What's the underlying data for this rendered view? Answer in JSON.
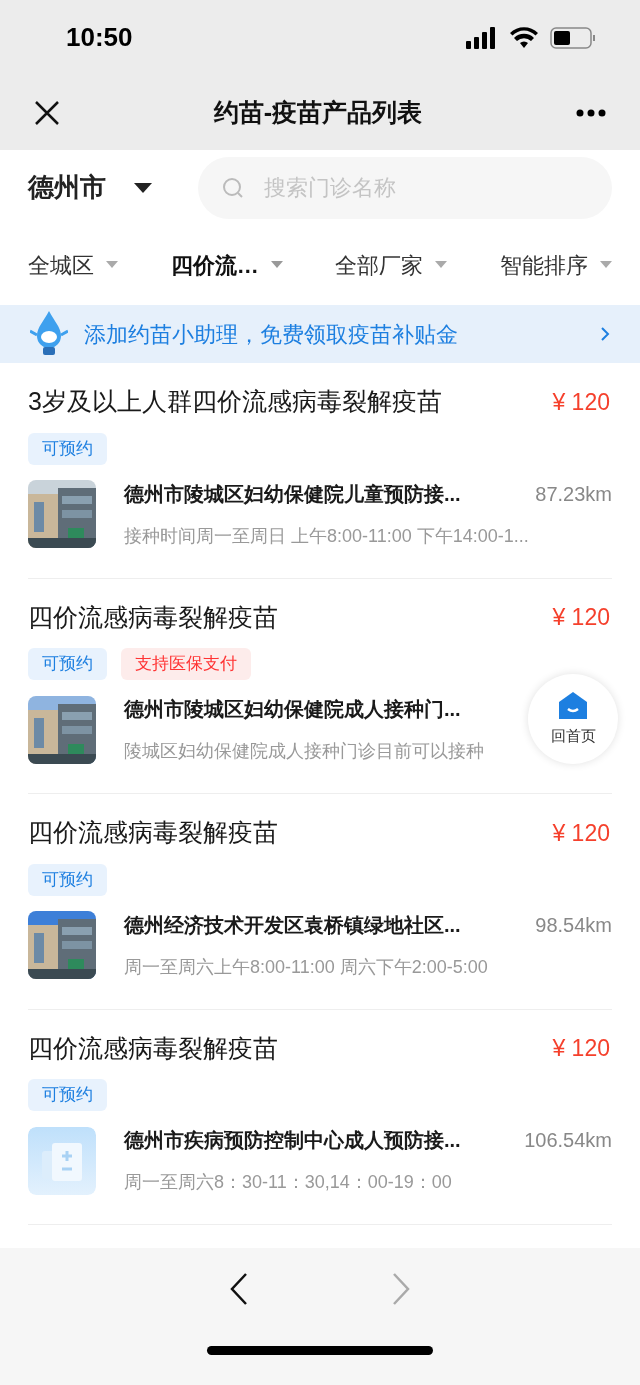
{
  "status_bar": {
    "time": "10:50"
  },
  "nav": {
    "title": "约苗-疫苗产品列表"
  },
  "city": {
    "label": "德州市"
  },
  "search": {
    "placeholder": "搜索门诊名称"
  },
  "filters": [
    {
      "label": "全城区",
      "selected": false
    },
    {
      "label": "四价流…",
      "selected": true
    },
    {
      "label": "全部厂家",
      "selected": false
    },
    {
      "label": "智能排序",
      "selected": false
    }
  ],
  "banner": {
    "text": "添加约苗小助理，免费领取疫苗补贴金"
  },
  "products": [
    {
      "name": "3岁及以上人群四价流感病毒裂解疫苗",
      "price": "¥ 120",
      "tags": [
        {
          "label": "可预约",
          "kind": "bookable"
        }
      ],
      "clinic": "德州市陵城区妇幼保健院儿童预防接...",
      "distance": "87.23km",
      "note": "接种时间周一至周日 上午8:00-11:00 下午14:00-1...",
      "thumbnail": {
        "kind": "picture"
      }
    },
    {
      "name": "四价流感病毒裂解疫苗",
      "price": "¥ 120",
      "tags": [
        {
          "label": "可预约",
          "kind": "bookable"
        },
        {
          "label": "支持医保支付",
          "kind": "insurance"
        }
      ],
      "clinic": "德州市陵城区妇幼保健院成人接种门...",
      "note": "陵城区妇幼保健院成人接种门诊目前可以接种",
      "thumbnail": {
        "kind": "picture"
      }
    },
    {
      "name": "四价流感病毒裂解疫苗",
      "price": "¥ 120",
      "tags": [
        {
          "label": "可预约",
          "kind": "bookable"
        }
      ],
      "clinic": "德州经济技术开发区袁桥镇绿地社区...",
      "distance": "98.54km",
      "note": "周一至周六上午8:00-11:00 周六下午2:00-5:00",
      "thumbnail": {
        "kind": "picture"
      }
    },
    {
      "name": "四价流感病毒裂解疫苗",
      "price": "¥ 120",
      "tags": [
        {
          "label": "可预约",
          "kind": "bookable"
        }
      ],
      "clinic": "德州市疾病预防控制中心成人预防接...",
      "distance": "106.54km",
      "note": "周一至周六8：30-11：30,14：00-19：00",
      "thumbnail": {
        "kind": "placeholder"
      }
    }
  ],
  "home_button": {
    "label": "回首页"
  }
}
